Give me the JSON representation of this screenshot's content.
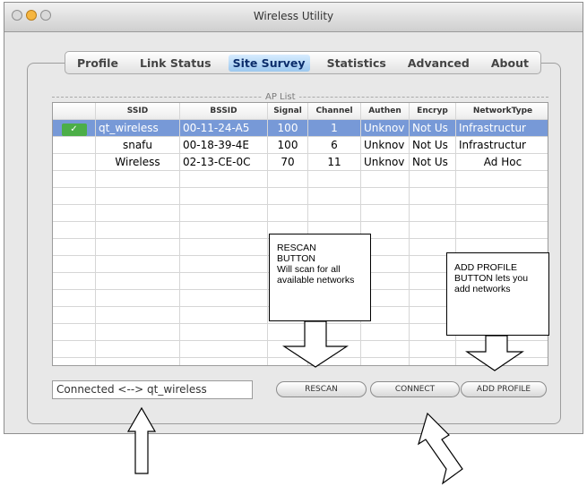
{
  "window": {
    "title": "Wireless Utility"
  },
  "tabs": [
    "Profile",
    "Link Status",
    "Site Survey",
    "Statistics",
    "Advanced",
    "About"
  ],
  "active_tab": "Site Survey",
  "ap_list": {
    "legend": "AP List",
    "columns": [
      "",
      "SSID",
      "BSSID",
      "Signal",
      "Channel",
      "Authen",
      "Encryp",
      "NetworkType"
    ],
    "rows": [
      {
        "icon": "wireless-connected-icon",
        "ssid": "qt_wireless",
        "bssid": "00-11-24-A5",
        "signal": "100",
        "channel": "1",
        "authen": "Unknov",
        "encryp": "Not Us",
        "network_type": "Infrastructur",
        "selected": true
      },
      {
        "icon": "",
        "ssid": "snafu",
        "bssid": "00-18-39-4E",
        "signal": "100",
        "channel": "6",
        "authen": "Unknov",
        "encryp": "Not Us",
        "network_type": "Infrastructur",
        "selected": false
      },
      {
        "icon": "",
        "ssid": "Wireless",
        "bssid": "02-13-CE-0C",
        "signal": "70",
        "channel": "11",
        "authen": "Unknov",
        "encryp": "Not Us",
        "network_type": "Ad Hoc",
        "selected": false
      }
    ]
  },
  "status": {
    "text": "Connected <--> qt_wireless"
  },
  "buttons": {
    "rescan": "RESCAN",
    "connect": "CONNECT",
    "add_profile": "ADD PROFILE"
  },
  "annotations": {
    "rescan": [
      "RESCAN",
      "BUTTON",
      "Will scan for all",
      "available networks"
    ],
    "add_profile": [
      "ADD PROFILE",
      "BUTTON lets you",
      "add networks"
    ]
  },
  "colors": {
    "selected_row": "#7799d7",
    "active_tab": "#9cc8ef",
    "connected_icon": "#4cae48"
  }
}
